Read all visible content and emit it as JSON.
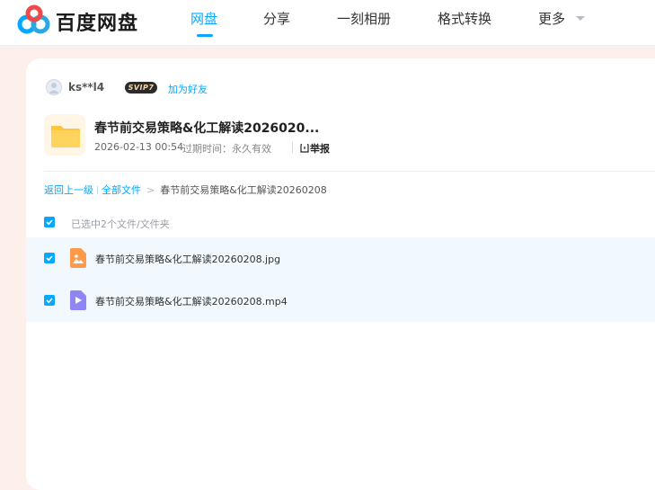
{
  "brand": {
    "name": "百度网盘",
    "logo_colors": [
      "#06a7ff",
      "#ef4a4a",
      "#2ea7e0"
    ]
  },
  "nav": {
    "items": [
      {
        "label": "网盘",
        "active": true
      },
      {
        "label": "分享",
        "active": false
      },
      {
        "label": "一刻相册",
        "active": false
      },
      {
        "label": "格式转换",
        "active": false
      },
      {
        "label": "更多",
        "active": false
      }
    ]
  },
  "share": {
    "username": "ks**l4",
    "vip_badge": "SVIP7",
    "add_friend": "加为好友",
    "folder_title": "春节前交易策略&化工解读2026020...",
    "date": "2026-02-13 00:54",
    "expire": "过期时间：永久有效",
    "report": "举报"
  },
  "breadcrumb": {
    "back": "返回上一级",
    "all_files": "全部文件",
    "arrow": ">",
    "current": "春节前交易策略&化工解读20260208"
  },
  "selection": {
    "text": "已选中2个文件/文件夹"
  },
  "files": [
    {
      "name": "春节前交易策略&化工解读20260208.jpg",
      "type": "image",
      "checked": true
    },
    {
      "name": "春节前交易策略&化工解读20260208.mp4",
      "type": "video",
      "checked": true
    }
  ],
  "colors": {
    "accent": "#06a7ff",
    "page_bg": "#fdf0ea",
    "row_bg": "#f1f8fe",
    "folder": "#ffc53d",
    "image_icon": "#ff9a4d",
    "video_icon": "#8f86f5"
  }
}
